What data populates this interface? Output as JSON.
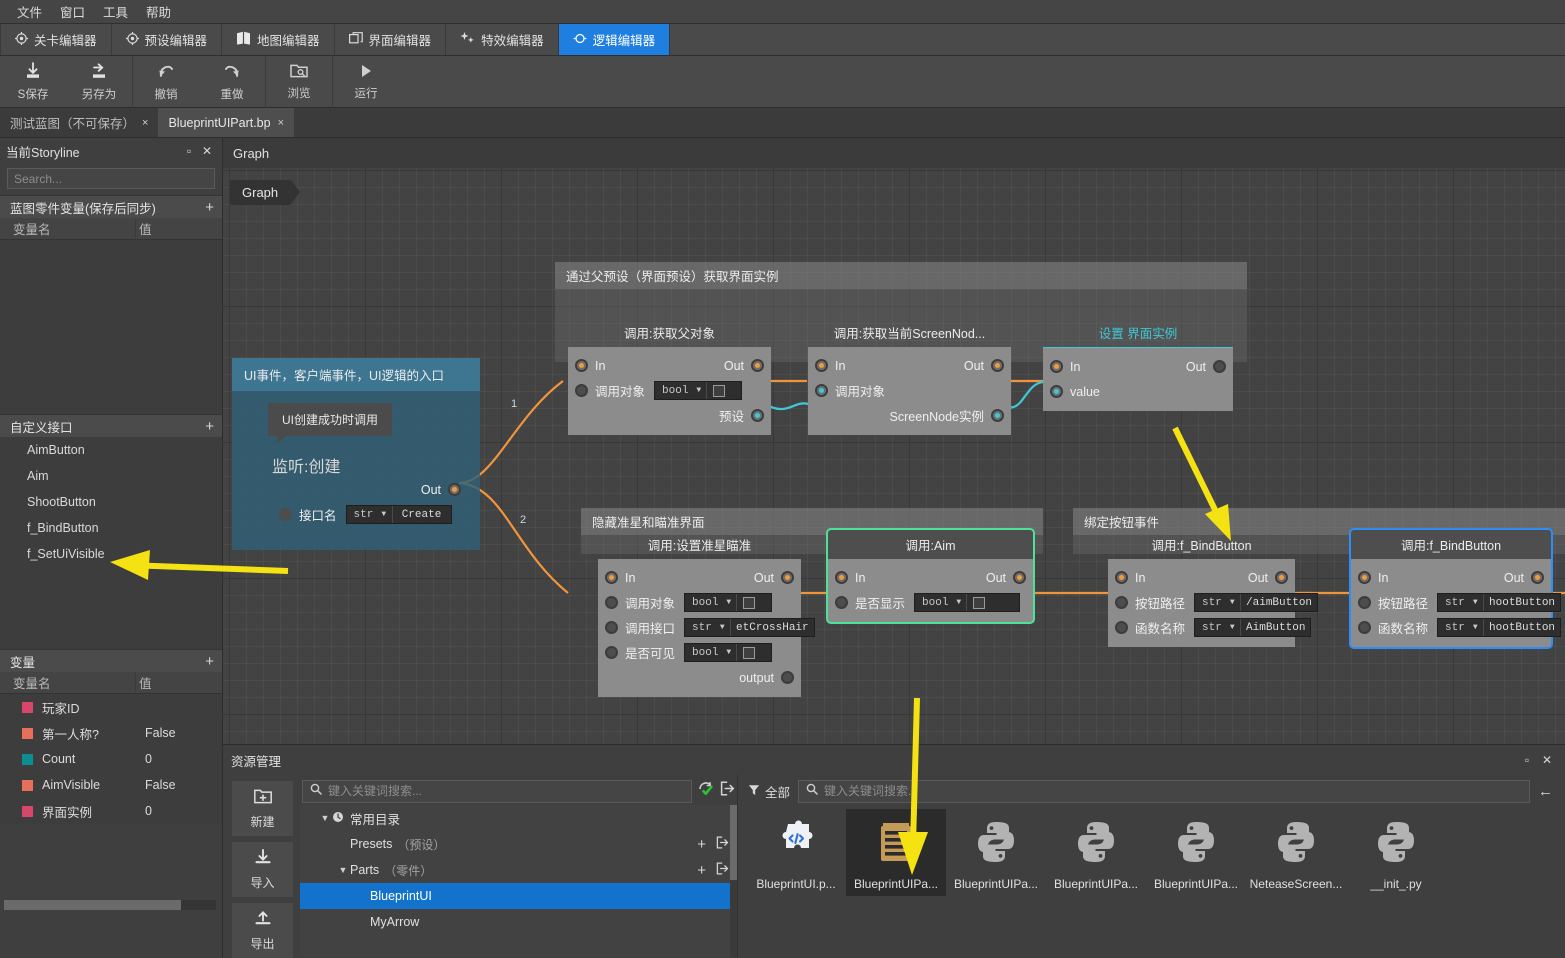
{
  "menubar": {
    "items": [
      "文件",
      "窗口",
      "工具",
      "帮助"
    ]
  },
  "mode_tabs": [
    {
      "label": "关卡编辑器",
      "icon": "target-icon",
      "active": false
    },
    {
      "label": "预设编辑器",
      "icon": "target-icon",
      "active": false
    },
    {
      "label": "地图编辑器",
      "icon": "map-icon",
      "active": false
    },
    {
      "label": "界面编辑器",
      "icon": "window-icon",
      "active": false
    },
    {
      "label": "特效编辑器",
      "icon": "sparkle-icon",
      "active": false
    },
    {
      "label": "逻辑编辑器",
      "icon": "node-icon",
      "active": true
    }
  ],
  "toolbar": {
    "groups": [
      [
        {
          "label": "S保存",
          "icon": "save-icon"
        },
        {
          "label": "另存为",
          "icon": "save-as-icon"
        }
      ],
      [
        {
          "label": "撤销",
          "icon": "undo-icon"
        },
        {
          "label": "重做",
          "icon": "redo-icon"
        }
      ],
      [
        {
          "label": "浏览",
          "icon": "browse-folder-icon"
        }
      ],
      [
        {
          "label": "运行",
          "icon": "play-icon"
        }
      ]
    ]
  },
  "doc_tabs": [
    {
      "label": "测试蓝图（不可保存）",
      "close": "×",
      "active": false
    },
    {
      "label": "BlueprintUIPart.bp",
      "close": "×",
      "active": true
    }
  ],
  "left_panel": {
    "title": "当前Storyline",
    "maximize_glyph": "▫",
    "close_glyph": "✕",
    "search_placeholder": "Search...",
    "blueprint_vars_section": {
      "title": "蓝图零件变量(保存后同步)",
      "add": "+"
    },
    "blueprint_cols": {
      "name": "变量名",
      "value": "值"
    },
    "custom_iface_section": {
      "title": "自定义接口",
      "add": "+"
    },
    "custom_iface_items": [
      "AimButton",
      "Aim",
      "ShootButton",
      "f_BindButton",
      "f_SetUiVisible"
    ],
    "vars_section": {
      "title": "变量",
      "add": "+"
    },
    "vars_cols": {
      "name": "变量名",
      "value": "值"
    },
    "vars": [
      {
        "name": "玩家ID",
        "value": "",
        "color": "#d8476a"
      },
      {
        "name": "第一人称?",
        "value": "False",
        "color": "#e8705a"
      },
      {
        "name": "Count",
        "value": "0",
        "color": "#0b8f92"
      },
      {
        "name": "AimVisible",
        "value": "False",
        "color": "#e8705a"
      },
      {
        "name": "界面实例",
        "value": "0",
        "color": "#d8476a"
      }
    ]
  },
  "graph": {
    "tabstrip_label": "Graph",
    "chip_label": "Graph",
    "groups": [
      {
        "title": "通过父预设（界面预设）获取界面实例"
      },
      {
        "title": "隐藏准星和瞄准界面"
      },
      {
        "title": "绑定按钮事件"
      }
    ],
    "event_node": {
      "header": "UI事件，客户端事件，UI逻辑的入口",
      "tooltip": "UI创建成功时调用",
      "inner_title": "监听:创建",
      "out_label": "Out",
      "param_label": "接口名",
      "param_type": "str",
      "param_value": "Create"
    },
    "wire_labels": [
      "1",
      "2"
    ],
    "nodes": [
      {
        "title": "调用:获取父对象",
        "rows": [
          {
            "in": "In",
            "out": "Out"
          },
          {
            "label": "调用对象",
            "type": "bool",
            "control": "checkbox"
          },
          {
            "right_label": "预设",
            "pin": "cyan"
          }
        ]
      },
      {
        "title": "调用:获取当前ScreenNod...",
        "rows": [
          {
            "in": "In",
            "out": "Out"
          },
          {
            "label": "调用对象",
            "pin": "cyan"
          },
          {
            "right_label": "ScreenNode实例",
            "pin": "cyan"
          }
        ]
      },
      {
        "title": "设置 界面实例",
        "style": "teal",
        "rows": [
          {
            "in": "In",
            "out": "Out"
          },
          {
            "label": "value",
            "pin": "cyan"
          }
        ]
      },
      {
        "title": "调用:设置准星瞄准",
        "rows": [
          {
            "in": "In",
            "out": "Out"
          },
          {
            "label": "调用对象",
            "type": "bool",
            "control": "checkbox"
          },
          {
            "label": "调用接口",
            "type": "str",
            "value": "etCrossHair"
          },
          {
            "label": "是否可见",
            "type": "bool",
            "control": "checkbox"
          },
          {
            "right_label": "output"
          }
        ]
      },
      {
        "title": "调用:Aim",
        "selected": "green",
        "rows": [
          {
            "in": "In",
            "out": "Out"
          },
          {
            "label": "是否显示",
            "type": "bool",
            "control": "checkbox"
          }
        ]
      },
      {
        "title": "调用:f_BindButton",
        "rows": [
          {
            "in": "In",
            "out": "Out"
          },
          {
            "label": "按钮路径",
            "type": "str",
            "value": "/aimButton"
          },
          {
            "label": "函数名称",
            "type": "str",
            "value": "AimButton"
          }
        ]
      },
      {
        "title": "调用:f_BindButton",
        "selected": "blue",
        "rows": [
          {
            "in": "In",
            "out": "Out"
          },
          {
            "label": "按钮路径",
            "type": "str",
            "value": "hootButton"
          },
          {
            "label": "函数名称",
            "type": "str",
            "value": "hootButton"
          }
        ]
      }
    ]
  },
  "bottom_panel": {
    "title": "资源管理",
    "maximize_glyph": "▫",
    "close_glyph": "✕",
    "side_buttons": [
      {
        "label": "新建",
        "icon": "new-folder-icon"
      },
      {
        "label": "导入",
        "icon": "import-icon"
      },
      {
        "label": "导出",
        "icon": "export-icon"
      }
    ],
    "tree_search_placeholder": "键入关键词搜索...",
    "tree": [
      {
        "label": "常用目录",
        "caret": "▼",
        "depth": 0,
        "icon": "clock-icon",
        "selected": false
      },
      {
        "label": "Presets",
        "sub": "（预设）",
        "depth": 1,
        "selected": false,
        "actions": [
          "+",
          "⊦"
        ]
      },
      {
        "label": "Parts",
        "sub": "（零件）",
        "caret": "▼",
        "depth": 1,
        "selected": false,
        "actions": [
          "+",
          "⊦"
        ]
      },
      {
        "label": "BlueprintUI",
        "depth": 2,
        "selected": true
      },
      {
        "label": "MyArrow",
        "depth": 2,
        "selected": false
      }
    ],
    "file_filter_label": "全部",
    "file_search_placeholder": "键入关键词搜索...",
    "back_glyph": "←",
    "files": [
      {
        "name": "BlueprintUI.p...",
        "icon": "puzzle-code-icon",
        "selected": false
      },
      {
        "name": "BlueprintUIPa...",
        "icon": "blueprint-doc-icon",
        "selected": true
      },
      {
        "name": "BlueprintUIPa...",
        "icon": "python-icon",
        "selected": false
      },
      {
        "name": "BlueprintUIPa...",
        "icon": "python-icon",
        "selected": false
      },
      {
        "name": "BlueprintUIPa...",
        "icon": "python-icon",
        "selected": false
      },
      {
        "name": "NeteaseScreen...",
        "icon": "python-icon",
        "selected": false
      },
      {
        "name": "__init_.py",
        "icon": "python-icon",
        "selected": false
      }
    ]
  },
  "annotations": {
    "arrow_color": "#f5e212",
    "arrows": [
      {
        "name": "arrow-to-f-bindbutton-iface"
      },
      {
        "name": "arrow-to-f-bindbutton-node"
      },
      {
        "name": "arrow-to-blueprintui-part-file"
      }
    ]
  }
}
